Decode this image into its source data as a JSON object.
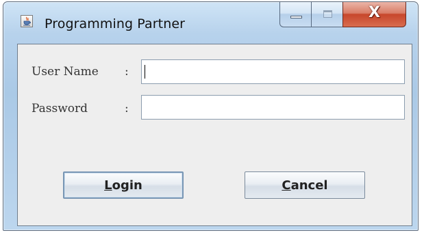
{
  "window": {
    "title": "Programming Partner",
    "close_glyph": "X"
  },
  "icons": {
    "app": "java-cup-icon",
    "minimize": "minimize-icon",
    "maximize": "maximize-icon",
    "close": "close-icon"
  },
  "form": {
    "username_label": "User Name",
    "password_label": "Password",
    "colon": ":",
    "username_value": "",
    "password_value": ""
  },
  "buttons": {
    "login_mnemonic": "L",
    "login_rest": "ogin",
    "cancel_mnemonic": "C",
    "cancel_rest": "ancel"
  },
  "colors": {
    "frame": "#aac9e6",
    "close_button": "#c7472c",
    "content_bg": "#eeeeee"
  }
}
